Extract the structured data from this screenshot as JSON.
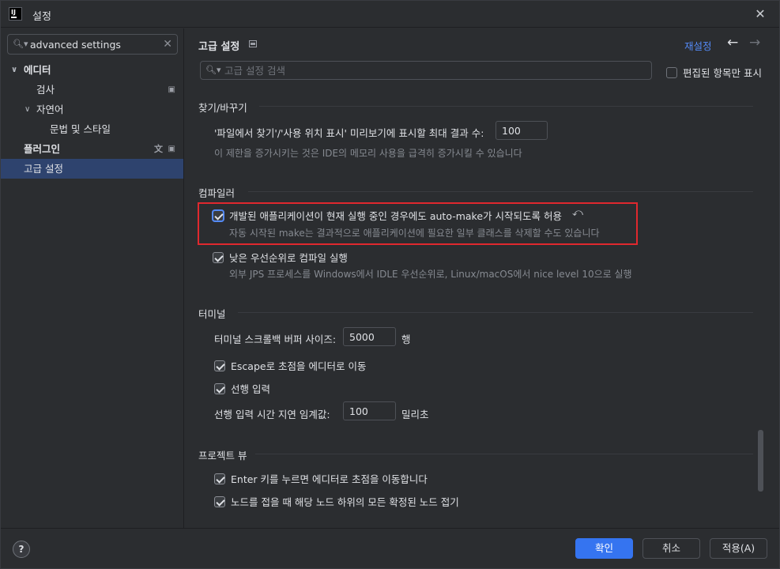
{
  "window": {
    "title": "설정",
    "logo_text": "IJ"
  },
  "sidebar": {
    "search_value": "advanced settings",
    "items": [
      {
        "label": "에디터",
        "expanded": true
      },
      {
        "label": "검사"
      },
      {
        "label": "자연어",
        "expanded": true
      },
      {
        "label": "문법 및 스타일"
      },
      {
        "label": "플러그인"
      },
      {
        "label": "고급 설정",
        "selected": true
      }
    ]
  },
  "header": {
    "title": "고급 설정",
    "reset_label": "재설정",
    "back_icon": "←",
    "forward_icon": "→"
  },
  "search": {
    "placeholder": "고급 설정 검색",
    "modified_only_label": "편집된 항목만 표시"
  },
  "find_replace": {
    "title": "찾기/바꾸기",
    "max_results_label": "'파일에서 찾기'/'사용 위치 표시' 미리보기에 표시할 최대 결과 수:",
    "max_results_value": "100",
    "max_results_hint": "이 제한을 증가시키는 것은 IDE의 메모리 사용을 급격히 증가시킬 수 있습니다"
  },
  "compiler": {
    "title": "컴파일러",
    "automake_label": "개발된 애플리케이션이 현재 실행 중인 경우에도 auto-make가 시작되도록 허용",
    "automake_checked": true,
    "automake_hint": "자동 시작된 make는 결과적으로 애플리케이션에 필요한 일부 클래스를 삭제할 수도 있습니다",
    "low_priority_label": "낮은 우선순위로 컴파일 실행",
    "low_priority_checked": true,
    "low_priority_hint": "외부 JPS 프로세스를 Windows에서 IDLE 우선순위로, Linux/macOS에서 nice level 10으로 실행"
  },
  "terminal": {
    "title": "터미널",
    "scroll_buffer_label": "터미널 스크롤백 버퍼 사이즈:",
    "scroll_buffer_value": "5000",
    "scroll_buffer_unit": "행",
    "escape_label": "Escape로 초점을 에디터로 이동",
    "escape_checked": true,
    "typeahead_label": "선행 입력",
    "typeahead_checked": true,
    "typeahead_delay_label": "선행 입력 시간 지연 임계값:",
    "typeahead_delay_value": "100",
    "typeahead_delay_unit": "밀리초"
  },
  "project_view": {
    "title": "프로젝트 뷰",
    "enter_label": "Enter 키를 누르면 에디터로 초점을 이동합니다",
    "enter_checked": true,
    "collapse_label": "노드를 접을 때 해당 노드 하위의 모든 확정된 노드 접기",
    "collapse_checked": true
  },
  "footer": {
    "help_label": "?",
    "ok_label": "확인",
    "cancel_label": "취소",
    "apply_label": "적용(A)"
  }
}
